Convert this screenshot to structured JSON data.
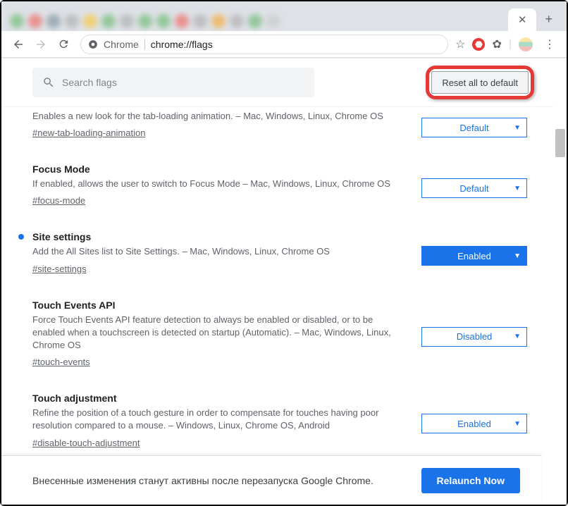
{
  "window": {
    "minimize": "—",
    "maximize": "☐",
    "close": "✕"
  },
  "tabstrip": {
    "active_close": "✕",
    "new_tab": "+"
  },
  "toolbar": {
    "url_prefix": "Chrome",
    "url_path": "chrome://flags"
  },
  "search": {
    "placeholder": "Search flags"
  },
  "reset": {
    "label": "Reset all to default"
  },
  "flags": [
    {
      "title": "",
      "desc": "Enables a new look for the tab-loading animation. – Mac, Windows, Linux, Chrome OS",
      "anchor": "#new-tab-loading-animation",
      "value": "Default",
      "style": "outline",
      "modified": false,
      "partial": true
    },
    {
      "title": "Focus Mode",
      "desc": "If enabled, allows the user to switch to Focus Mode – Mac, Windows, Linux, Chrome OS",
      "anchor": "#focus-mode",
      "value": "Default",
      "style": "outline",
      "modified": false
    },
    {
      "title": "Site settings",
      "desc": "Add the All Sites list to Site Settings. – Mac, Windows, Linux, Chrome OS",
      "anchor": "#site-settings",
      "value": "Enabled",
      "style": "filled",
      "modified": true
    },
    {
      "title": "Touch Events API",
      "desc": "Force Touch Events API feature detection to always be enabled or disabled, or to be enabled when a touchscreen is detected on startup (Automatic). – Mac, Windows, Linux, Chrome OS",
      "anchor": "#touch-events",
      "value": "Disabled",
      "style": "outline",
      "modified": false
    },
    {
      "title": "Touch adjustment",
      "desc": "Refine the position of a touch gesture in order to compensate for touches having poor resolution compared to a mouse. – Windows, Linux, Chrome OS, Android",
      "anchor": "#disable-touch-adjustment",
      "value": "Enabled",
      "style": "outline",
      "modified": false
    }
  ],
  "footer": {
    "message": "Внесенные изменения станут активны после перезапуска Google Chrome.",
    "button": "Relaunch Now"
  }
}
